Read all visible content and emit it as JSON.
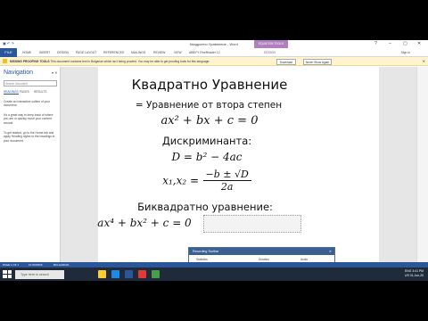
{
  "window": {
    "title": "Квадратно Уравнение - Word",
    "context_group": "EQUATION TOOLS",
    "minimize": "–",
    "restore": "▢",
    "close": "✕",
    "help": "?"
  },
  "ribbon": {
    "file": "FILE",
    "tabs": [
      "HOME",
      "INSERT",
      "DESIGN",
      "PAGE LAYOUT",
      "REFERENCES",
      "MAILINGS",
      "REVIEW",
      "VIEW",
      "ABBYY FineReader 12"
    ],
    "context_tab": "DESIGN",
    "user": "Sign in"
  },
  "message_bar": {
    "title": "MISSING PROOFING TOOLS",
    "text": "This document contains text in Bulgarian which isn't being proofed. You may be able to get proofing tools for this language.",
    "download_label": "Download",
    "never_label": "Never Show Again"
  },
  "navigation": {
    "title": "Navigation",
    "search_placeholder": "Search document",
    "tabs": [
      "HEADINGS",
      "PAGES",
      "RESULTS"
    ],
    "paragraphs": [
      "Create an interactive outline of your document.",
      "It's a great way to keep track of where you are or quickly move your content around.",
      "To get started, go to the Home tab and apply Heading styles to the headings in your document."
    ]
  },
  "document": {
    "heading": "Квадратно Уравнение",
    "subtitle": "= Уравнение от втора степен",
    "equation": "ax² + bx + c = 0",
    "discriminant_label": "Дискриминанта:",
    "discriminant_eq": "D = b² − 4ac",
    "roots_lhs": "x₁,x₂ =",
    "roots_numerator": "−b ± √D",
    "roots_denominator": "2a",
    "biquadratic_label": "Биквадратно уравнение:",
    "biquadratic_eq": "ax⁴ + bx² + c = 0"
  },
  "recording_toolbar": {
    "title": "Recording Toolbar",
    "labels": [
      "Statistics",
      "Duration",
      "Audio",
      "Mode",
      "Video"
    ]
  },
  "status_bar": {
    "page": "PAGE 1 OF 1",
    "words": "10 WORDS",
    "language": "BULGARIAN"
  },
  "taskbar": {
    "search_placeholder": "Type here to search",
    "lang": "ENG",
    "region": "US",
    "time": "3:41 PM",
    "date": "01-Jun-20",
    "icon_colors": [
      "#ffcc33",
      "#1e88e5",
      "#2b579a",
      "#e53935",
      "#43a047"
    ]
  }
}
